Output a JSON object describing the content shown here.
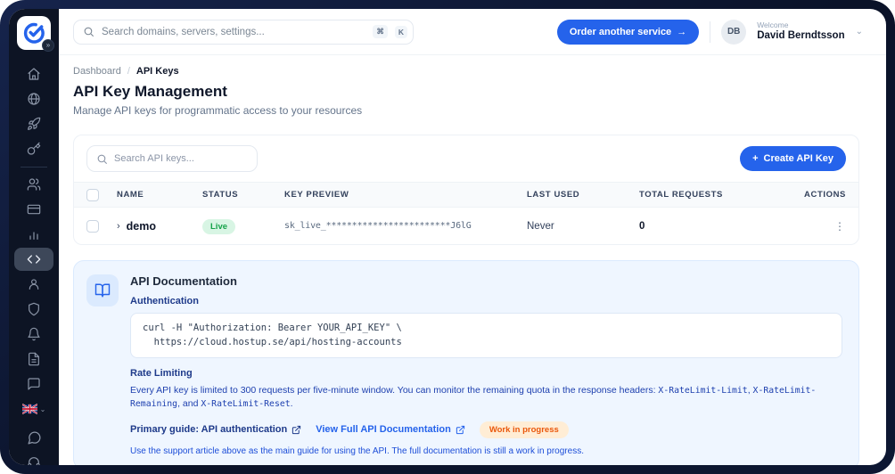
{
  "topbar": {
    "search_placeholder": "Search domains, servers, settings...",
    "kbd": [
      "⌘",
      "K"
    ],
    "order_label": "Order another service",
    "order_arrow": "→",
    "avatar_initials": "DB",
    "welcome": "Welcome",
    "user_name": "David Berndtsson"
  },
  "sidebar": {
    "expand_glyph": "»",
    "icons": [
      "home",
      "globe",
      "rocket",
      "key",
      "users",
      "credit-card",
      "bar-chart",
      "code",
      "user",
      "shield",
      "bell",
      "file-text",
      "message-square",
      "language-flag-uk",
      "chat-bubble",
      "headset-partial"
    ],
    "active_icon": "code"
  },
  "breadcrumb": {
    "parent": "Dashboard",
    "separator": "/",
    "current": "API Keys"
  },
  "page": {
    "title": "API Key Management",
    "subtitle": "Manage API keys for programmatic access to your resources"
  },
  "table": {
    "search_placeholder": "Search API keys...",
    "create_plus": "+",
    "create_label": "Create API Key",
    "columns": [
      "NAME",
      "STATUS",
      "KEY PREVIEW",
      "LAST USED",
      "TOTAL REQUESTS",
      "ACTIONS"
    ],
    "rows": [
      {
        "expander": "›",
        "name": "demo",
        "status": "Live",
        "key_preview": "sk_live_************************J6lG",
        "last_used": "Never",
        "total_requests": "0",
        "actions_glyph": "⋮"
      }
    ]
  },
  "docs": {
    "title": "API Documentation",
    "auth_label": "Authentication",
    "code_line1": "curl -H \"Authorization: Bearer YOUR_API_KEY\" \\",
    "code_line2": "  https://cloud.hostup.se/api/hosting-accounts",
    "rate_title": "Rate Limiting",
    "rate_prefix": "Every API key is limited to 300 requests per five-minute window. You can monitor the remaining quota in the response headers: ",
    "rate_mono1": "X-RateLimit-Limit",
    "rate_sep1": ", ",
    "rate_mono2": "X-RateLimit-Remaining",
    "rate_sep2": ", and ",
    "rate_mono3": "X-RateLimit-Reset",
    "rate_suffix": ".",
    "primary_guide_label": "Primary guide: API authentication",
    "view_full_label": "View Full API Documentation",
    "wip_badge": "Work in progress",
    "footnote": "Use the support article above as the main guide for using the API. The full documentation is still a work in progress."
  },
  "colors": {
    "accent_blue": "#2563eb",
    "sidebar_bg": "#0d1424",
    "live_badge_bg": "#d8f5e4",
    "live_badge_text": "#16a34a",
    "wip_badge_bg": "#ffedd5",
    "wip_badge_text": "#ea580c",
    "docs_panel_bg": "#eff6ff"
  }
}
